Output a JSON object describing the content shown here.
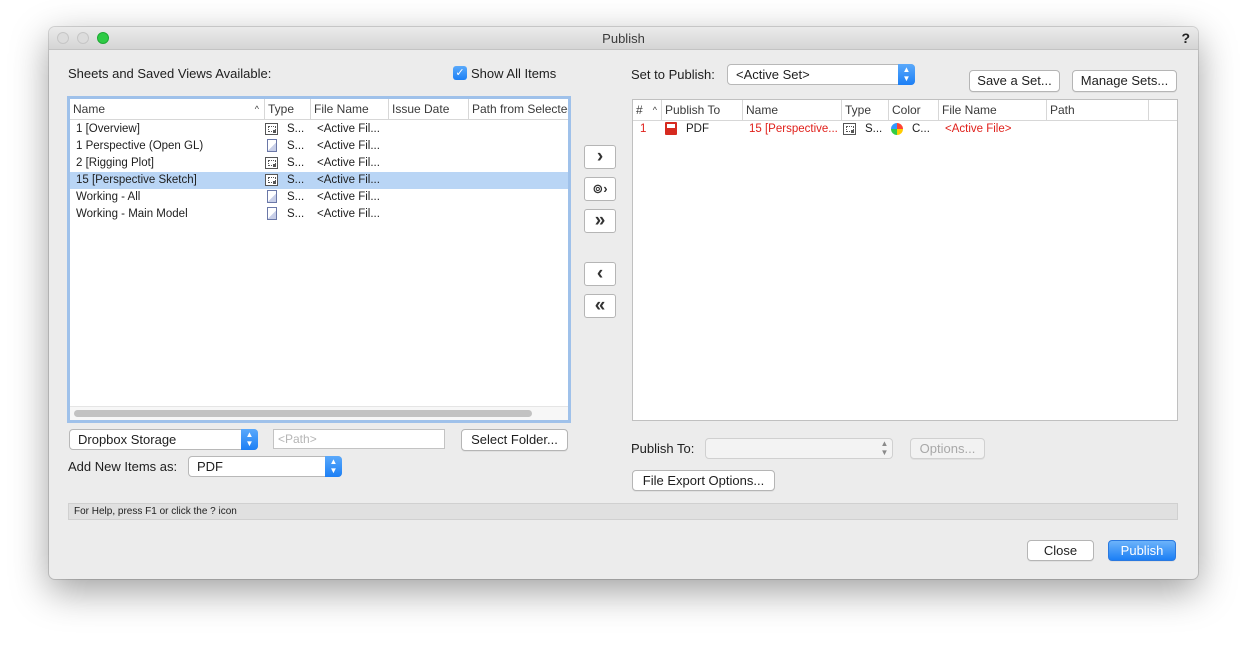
{
  "window": {
    "title": "Publish",
    "help_icon": "?"
  },
  "left": {
    "label": "Sheets and Saved Views Available:",
    "show_all_label": "Show All Items",
    "show_all_checked": true,
    "columns": [
      "Name",
      "Type",
      "File Name",
      "Issue Date",
      "Path from Selected"
    ],
    "rows": [
      {
        "name": "1 [Overview]",
        "type_icon": "sheet-layer-icon",
        "type": "S...",
        "file": "<Active Fil..."
      },
      {
        "name": "1 Perspective (Open GL)",
        "type_icon": "saved-view-icon",
        "type": "S...",
        "file": "<Active Fil..."
      },
      {
        "name": "2 [Rigging Plot]",
        "type_icon": "sheet-layer-icon",
        "type": "S...",
        "file": "<Active Fil..."
      },
      {
        "name": "15 [Perspective Sketch]",
        "type_icon": "sheet-layer-icon",
        "type": "S...",
        "file": "<Active Fil...",
        "selected": true
      },
      {
        "name": "Working - All",
        "type_icon": "saved-view-icon",
        "type": "S...",
        "file": "<Active Fil..."
      },
      {
        "name": "Working - Main Model",
        "type_icon": "saved-view-icon",
        "type": "S...",
        "file": "<Active Fil..."
      }
    ],
    "storage_value": "Dropbox Storage",
    "path_placeholder": "<Path>",
    "select_folder_label": "Select Folder...",
    "add_new_label": "Add New Items as:",
    "add_new_value": "PDF"
  },
  "right": {
    "set_label": "Set to Publish:",
    "set_value": "<Active Set>",
    "save_set_label": "Save a Set...",
    "manage_sets_label": "Manage Sets...",
    "columns": [
      "#",
      "Publish To",
      "Name",
      "Type",
      "Color",
      "File Name",
      "Path"
    ],
    "rows": [
      {
        "num": "1",
        "publish_to": "PDF",
        "name": "15 [Perspective...",
        "type": "S...",
        "color": "C...",
        "file": "<Active File>"
      }
    ],
    "publish_to_label": "Publish To:",
    "publish_to_value": "",
    "options_label": "Options...",
    "file_export_label": "File Export Options..."
  },
  "status": "For Help, press F1 or click the ? icon",
  "footer": {
    "close_label": "Close",
    "publish_label": "Publish"
  },
  "accent_color": "#1c7ff5",
  "error_color": "#e0201b"
}
